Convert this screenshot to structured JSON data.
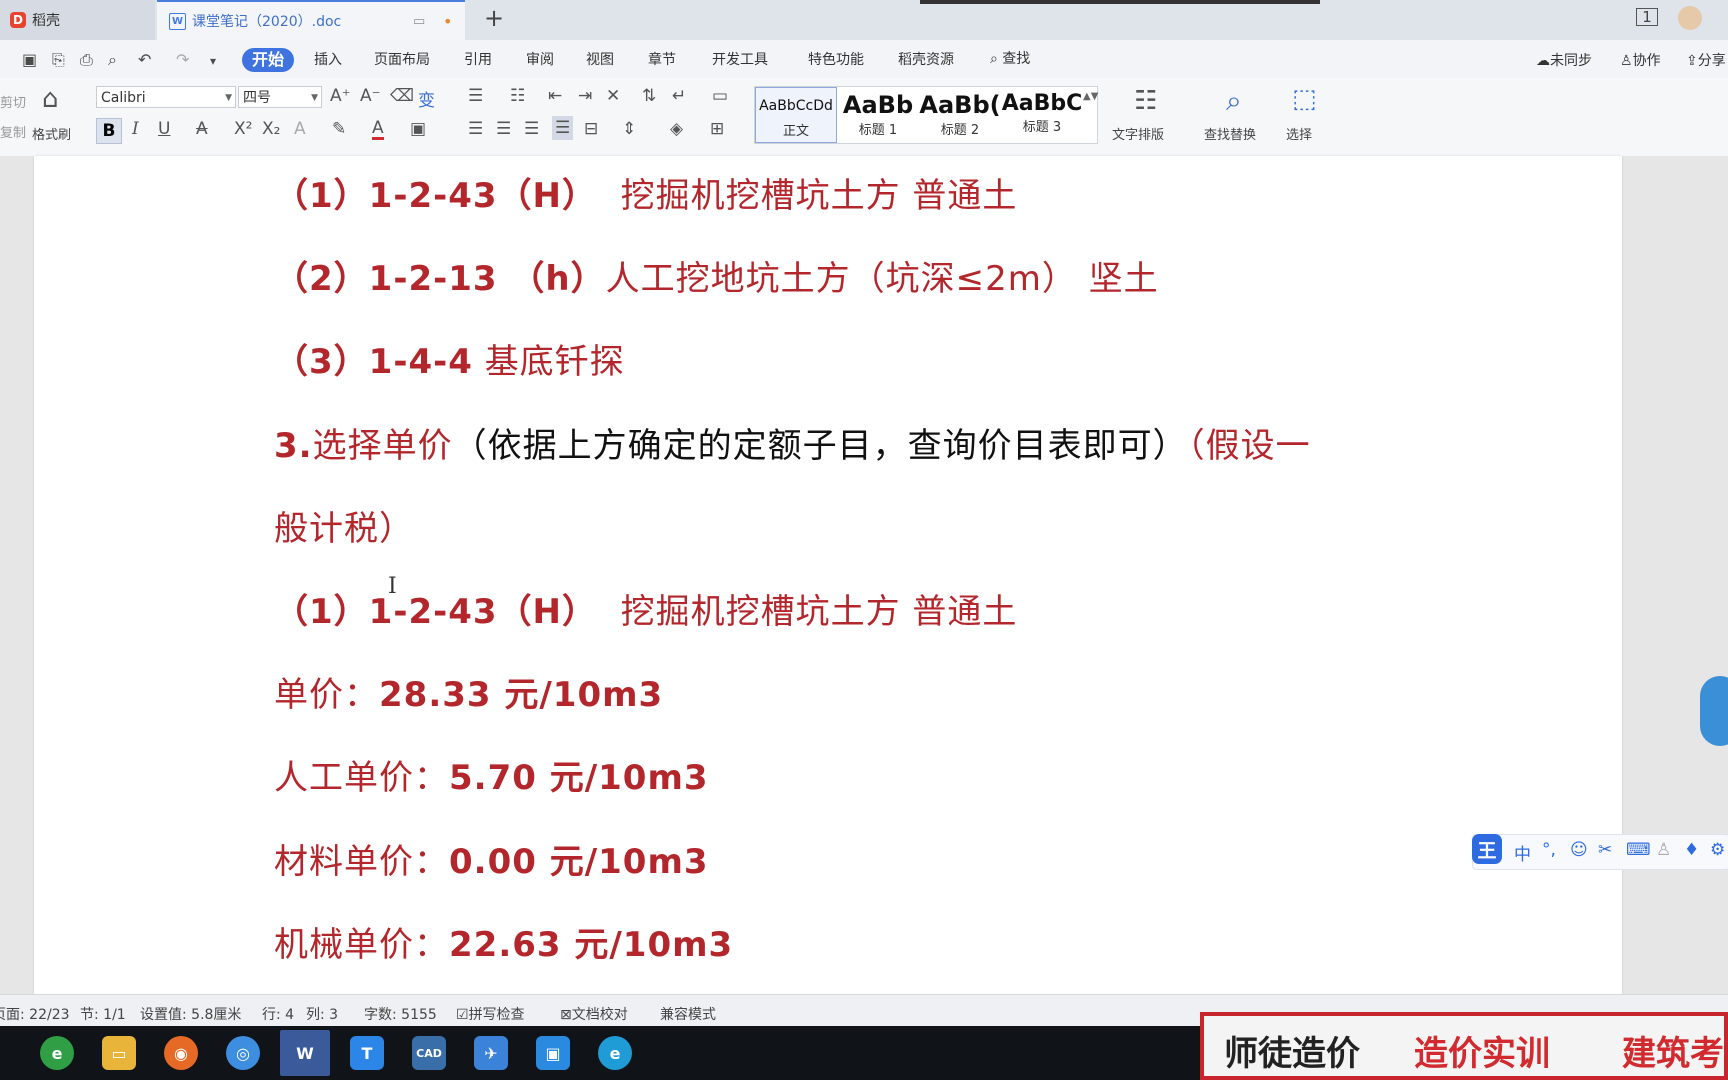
{
  "titlebar": {
    "home_tab": "稻壳",
    "doc_tab": "课堂笔记（2020）.doc",
    "new_tab": "+"
  },
  "menu": {
    "items": [
      "开始",
      "插入",
      "页面布局",
      "引用",
      "审阅",
      "视图",
      "章节",
      "开发工具",
      "特色功能",
      "稻壳资源"
    ],
    "search": "查找",
    "sync": "未同步",
    "collab": "协作",
    "share": "分享"
  },
  "ribbon": {
    "cut": "剪切",
    "copy": "复制",
    "format_painter": "格式刷",
    "font": "Calibri",
    "size": "四号",
    "styles": [
      {
        "preview": "AaBbCcDd",
        "label": "正文"
      },
      {
        "preview": "AaBb",
        "label": "标题 1"
      },
      {
        "preview": "AaBb(",
        "label": "标题 2"
      },
      {
        "preview": "AaBbC",
        "label": "标题 3"
      }
    ],
    "text_layout": "文字排版",
    "find_replace": "查找替换",
    "select": "选择"
  },
  "document": {
    "l1_idx": "（1）",
    "l1_code": "1-2-43（H）",
    "l1_desc": "挖掘机挖槽坑土方  普通土",
    "l2_idx": "（2）",
    "l2_code": "1-2-13 （h）",
    "l2_desc": "人工挖地坑土方（坑深≤2m）  坚土",
    "l3_idx": "（3）",
    "l3_code": "1-4-4",
    "l3_desc": "基底钎探",
    "l4_num": "3.",
    "l4_red": "选择单价",
    "l4_black": "（依据上方确定的定额子目，查询价目表即可）",
    "l4_tail": "（假设一",
    "l5": "般计税）",
    "l6_idx": "（1）",
    "l6_code": "1-2-43（H）",
    "l6_desc": "挖掘机挖槽坑土方  普通土",
    "p1_label": "单价：",
    "p1_value": "28.33 元/10m3",
    "p2_label": "人工单价：",
    "p2_value": "5.70 元/10m3",
    "p3_label": "材料单价：",
    "p3_value": "0.00 元/10m3",
    "p4_label": "机械单价：",
    "p4_value": "22.63 元/10m3"
  },
  "status": {
    "page": "页面: 22/23",
    "section": "节: 1/1",
    "setting": "设置值: 5.8厘米",
    "row": "行: 4",
    "col": "列: 3",
    "words": "字数: 5155",
    "spell": "拼写检查",
    "proof": "文档校对",
    "compat": "兼容模式"
  },
  "ime": {
    "logo": "王",
    "mode": "中"
  },
  "banner": {
    "a": "师徒造价",
    "b": "造价实训",
    "c": "建筑考"
  }
}
